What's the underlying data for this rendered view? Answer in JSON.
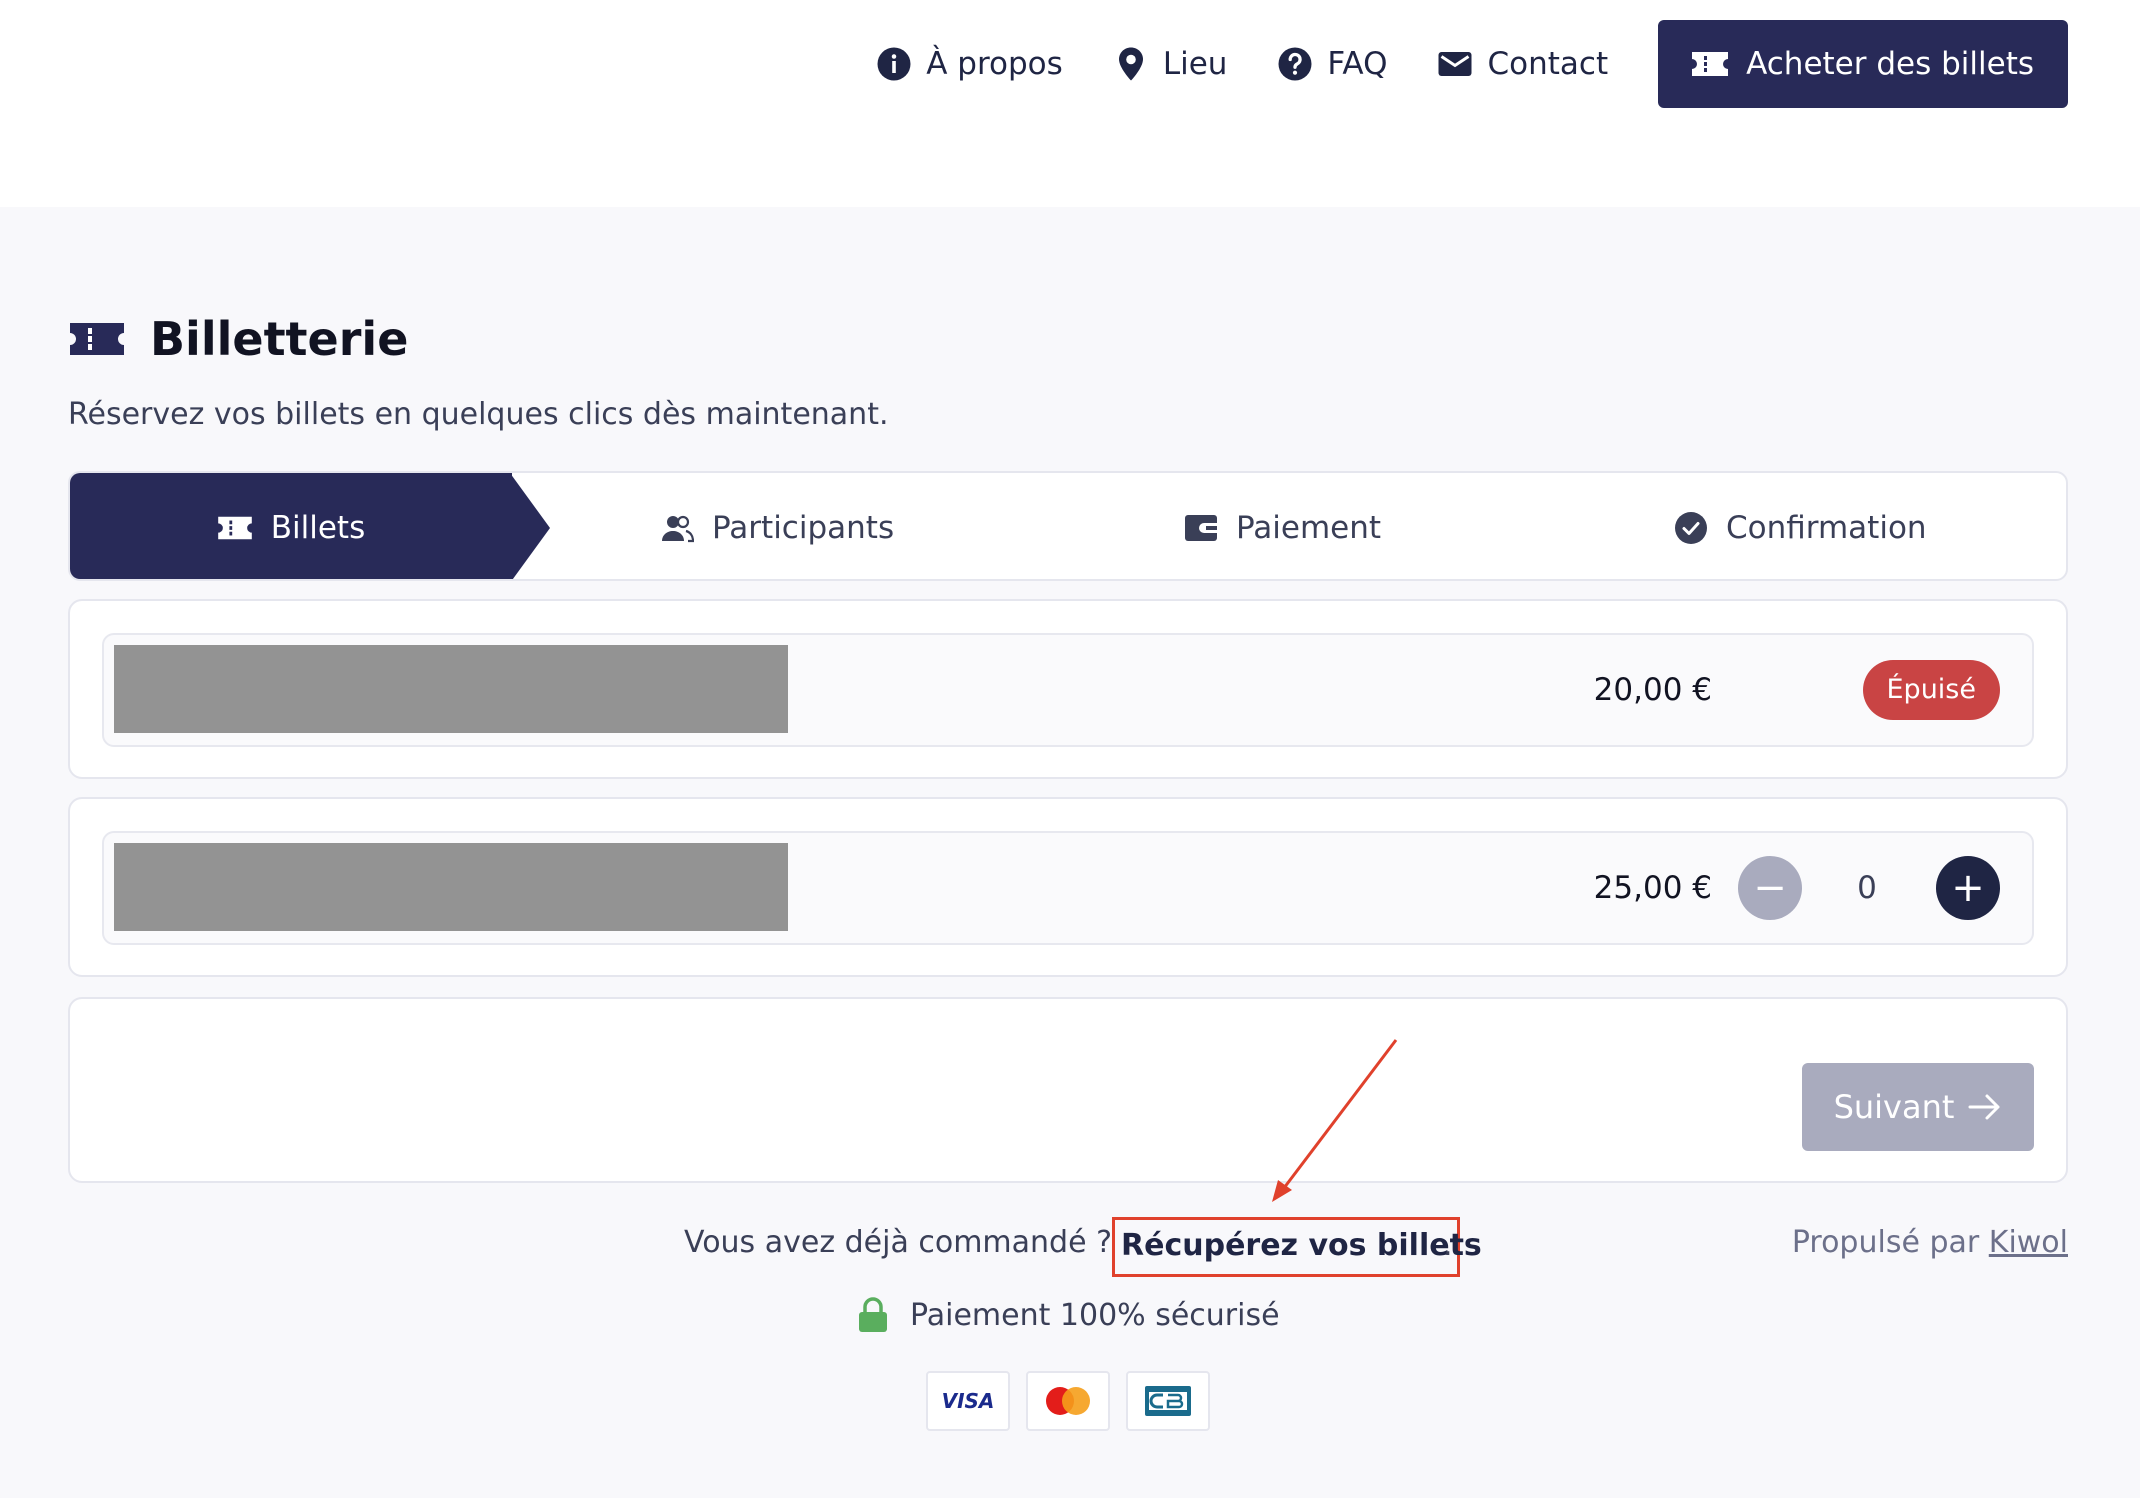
{
  "nav": {
    "items": [
      {
        "label": "À propos",
        "icon": "info-icon"
      },
      {
        "label": "Lieu",
        "icon": "location-icon"
      },
      {
        "label": "FAQ",
        "icon": "question-icon"
      },
      {
        "label": "Contact",
        "icon": "mail-icon"
      }
    ],
    "buy_button": "Acheter des billets"
  },
  "header": {
    "title": "Billetterie",
    "subtitle": "Réservez vos billets en quelques clics dès maintenant."
  },
  "steps": [
    {
      "label": "Billets",
      "active": true
    },
    {
      "label": "Participants",
      "active": false
    },
    {
      "label": "Paiement",
      "active": false
    },
    {
      "label": "Confirmation",
      "active": false
    }
  ],
  "tickets": [
    {
      "price": "20,00 €",
      "status": "Épuisé"
    },
    {
      "price": "25,00 €",
      "quantity": "0",
      "minus": "−",
      "plus": "+"
    }
  ],
  "next_button": "Suivant",
  "footer": {
    "already_ordered": "Vous avez déjà commandé ?",
    "retrieve_link": "Récupérez vos billets",
    "retrieve_dot": ".",
    "powered_by": "Propulsé par",
    "powered_link": "Kiwol",
    "secure": "Paiement 100% sécurisé",
    "payment_cards": [
      "VISA",
      "Mastercard",
      "CB"
    ]
  },
  "colors": {
    "primary": "#282a58",
    "disabled": "#a9abbe",
    "sold_out": "#c94444",
    "annotation": "#e0412c",
    "lock": "#5aae5e"
  }
}
